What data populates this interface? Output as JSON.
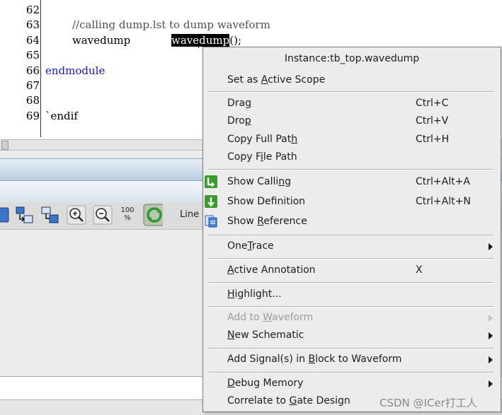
{
  "editor": {
    "line_numbers": [
      "62",
      "63",
      "64",
      "65",
      "66",
      "67",
      "68",
      "69"
    ],
    "lines": {
      "l63_comment": "//calling dump.lst to dump waveform",
      "l64_module": "wavedump",
      "l64_inst_before": "wave",
      "l64_inst_selected": "dump",
      "l64_tail": "();",
      "l66_keyword": "endmodule",
      "l69_directive": "`endif"
    }
  },
  "toolbar": {
    "zoom_percent": "100\n%",
    "line_label": "Line"
  },
  "context_menu": {
    "title": "Instance:tb_top.wavedump",
    "items": [
      {
        "pre": "Set as ",
        "u": "A",
        "post": "ctive Scope",
        "shortcut": ""
      },
      {
        "pre": "Dra",
        "u": "g",
        "post": "",
        "shortcut": "Ctrl+C"
      },
      {
        "pre": "Dro",
        "u": "p",
        "post": "",
        "shortcut": "Ctrl+V"
      },
      {
        "pre": "Copy Full Pat",
        "u": "h",
        "post": "",
        "shortcut": "Ctrl+H"
      },
      {
        "pre": "Copy F",
        "u": "i",
        "post": "le Path",
        "shortcut": ""
      },
      {
        "pre": "Show Calli",
        "u": "n",
        "post": "g",
        "shortcut": "Ctrl+Alt+A"
      },
      {
        "pre": "Show Def",
        "u": "i",
        "post": "nition",
        "shortcut": "Ctrl+Alt+N"
      },
      {
        "pre": "Show ",
        "u": "R",
        "post": "eference",
        "shortcut": ""
      },
      {
        "pre": "One",
        "u": "T",
        "post": "race",
        "shortcut": ""
      },
      {
        "pre": "",
        "u": "A",
        "post": "ctive Annotation",
        "shortcut": "X"
      },
      {
        "pre": "",
        "u": "H",
        "post": "ighlight...",
        "shortcut": ""
      },
      {
        "pre": "Add to ",
        "u": "W",
        "post": "aveform",
        "shortcut": ""
      },
      {
        "pre": "",
        "u": "N",
        "post": "ew Schematic",
        "shortcut": ""
      },
      {
        "pre": "Add Signal(s) in ",
        "u": "B",
        "post": "lock to Waveform",
        "shortcut": ""
      },
      {
        "pre": "",
        "u": "D",
        "post": "ebug Memory",
        "shortcut": ""
      },
      {
        "pre": "Correlate to ",
        "u": "G",
        "post": "ate Design",
        "shortcut": ""
      }
    ]
  },
  "icons": {
    "show_calling": "green-calling-icon",
    "show_definition": "green-definition-icon",
    "show_reference": "blue-reference-icon"
  },
  "colors": {
    "menu_bg": "#ececec",
    "keyword": "#1515cc",
    "selection_bg": "#000000",
    "disabled_text": "#9c9c9c"
  },
  "watermark": "CSDN @ICer打工人"
}
